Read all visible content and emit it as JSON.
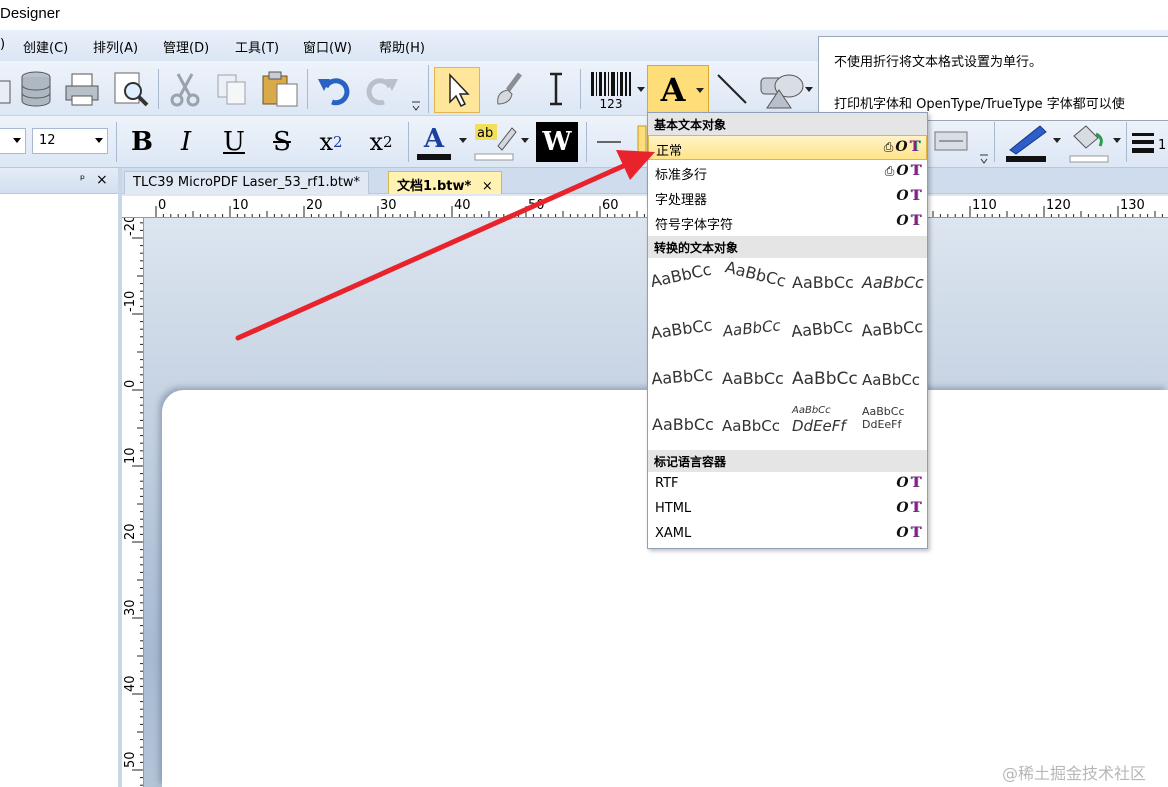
{
  "window": {
    "title_fragment": "Designer"
  },
  "menu": [
    "创建(C)",
    "排列(A)",
    "管理(D)",
    "工具(T)",
    "窗口(W)",
    "帮助(H)"
  ],
  "menu_leading_fragment": ")",
  "format_toolbar": {
    "font_size": "12"
  },
  "panel": {
    "pin_glyph": "ᵖ",
    "close_glyph": "×"
  },
  "tabs": [
    {
      "label": "TLC39 MicroPDF Laser_53_rf1.btw*",
      "active": false
    },
    {
      "label": "文档1.btw*",
      "active": true
    }
  ],
  "tab_close_glyph": "×",
  "ruler": {
    "h_labels": [
      "0",
      "10",
      "20",
      "30",
      "40",
      "50",
      "60",
      "110",
      "120",
      "130"
    ],
    "v_labels": [
      "-20",
      "-10",
      "0",
      "10",
      "20",
      "30",
      "40",
      "50"
    ]
  },
  "toolbar": {
    "barcode_number": "123",
    "text_tool_letter": "A"
  },
  "tooltip": {
    "line1": "不使用折行将文本格式设置为单行。",
    "line2": "打印机字体和 OpenType/TrueType 字体都可以使"
  },
  "dropdown": {
    "section_basic": "基本文本对象",
    "basic_items": [
      {
        "label": "正常",
        "printer_flag": true,
        "highlighted": true
      },
      {
        "label": "标准多行",
        "printer_flag": true,
        "highlighted": false
      },
      {
        "label": "字处理器",
        "printer_flag": false,
        "highlighted": false
      },
      {
        "label": "符号字体字符",
        "printer_flag": false,
        "highlighted": false
      }
    ],
    "section_transformed": "转换的文本对象",
    "sample_text": "AaBbCc",
    "sample_text_long": [
      "AaBbCc",
      "DdEeFf"
    ],
    "section_markup": "标记语言容器",
    "markup_items": [
      "RTF",
      "HTML",
      "XAML"
    ],
    "flag_o": "O",
    "flag_t": "T",
    "flag_printer": "⎙"
  },
  "watermark": "@稀土掘金技术社区",
  "colors": {
    "accent": "#ffe48a",
    "arrow": "#e8232b",
    "menu_bg": "#dbe6f4"
  }
}
